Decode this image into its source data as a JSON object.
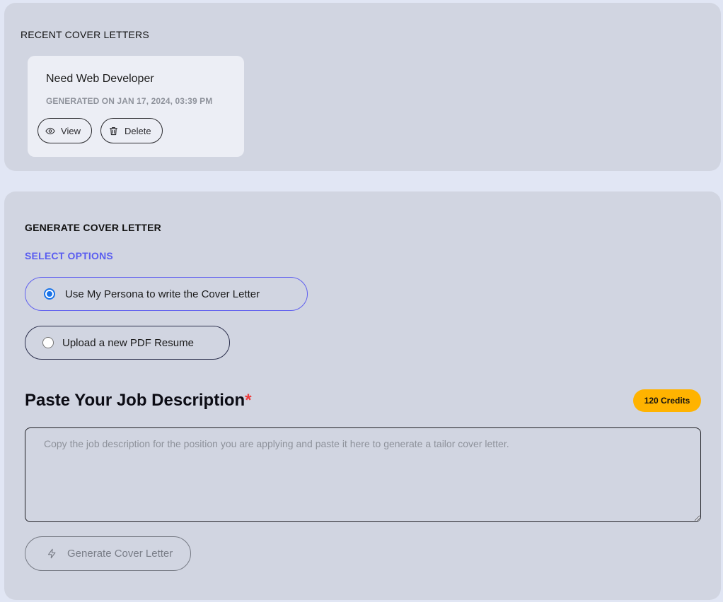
{
  "recent": {
    "heading": "RECENT COVER LETTERS",
    "letters": [
      {
        "title": "Need Web Developer",
        "date": "GENERATED ON JAN 17, 2024, 03:39 PM",
        "view_label": "View",
        "delete_label": "Delete"
      }
    ]
  },
  "generate": {
    "heading": "GENERATE COVER LETTER",
    "select_options_label": "SELECT OPTIONS",
    "options": [
      {
        "label": "Use My Persona to write the Cover Letter",
        "selected": true
      },
      {
        "label": "Upload a new PDF Resume",
        "selected": false
      }
    ],
    "job_heading": "Paste Your Job Description",
    "required_mark": "*",
    "credits": "120 Credits",
    "textarea_value": "",
    "textarea_placeholder": "Copy the job description for the position you are applying and paste it here to generate a tailor cover letter.",
    "generate_button": "Generate Cover Letter"
  },
  "colors": {
    "accent": "#5b5ef0",
    "credits_badge": "#ffb300",
    "required": "#ee3b3b",
    "panel_bg": "#d1d5e1",
    "page_bg": "#e1e6f4"
  },
  "icons": {
    "view": "eye-icon",
    "delete": "trash-icon",
    "generate": "lightning-bolt-icon"
  }
}
